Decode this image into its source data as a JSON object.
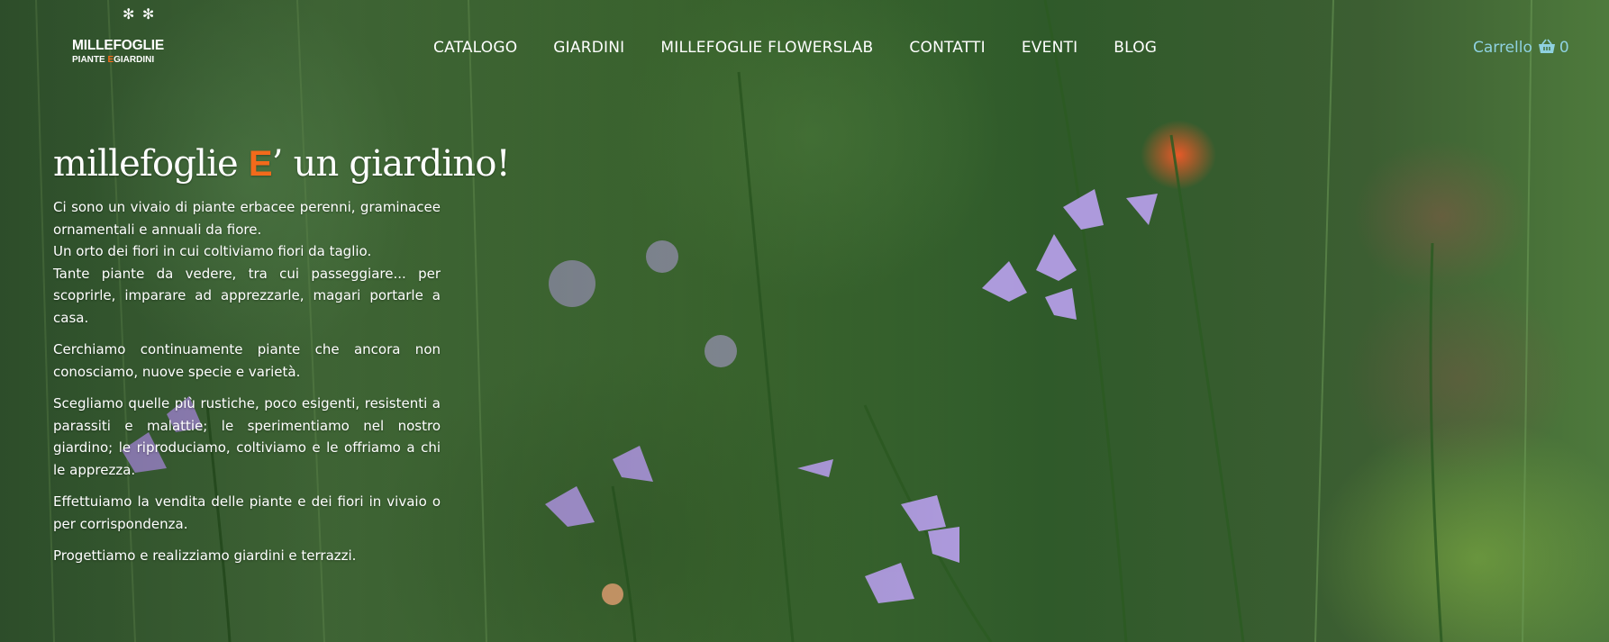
{
  "header": {
    "logo": {
      "line1": "MILLEFOGLIE",
      "line2_a": "PIANTE ",
      "line2_e": "E",
      "line2_b": "GIARDINI",
      "mark": "✻ ✻"
    },
    "nav": [
      {
        "label": "CATALOGO"
      },
      {
        "label": "GIARDINI"
      },
      {
        "label": "MILLEFOGLIE FLOWERSLAB"
      },
      {
        "label": "CONTATTI"
      },
      {
        "label": "EVENTI"
      },
      {
        "label": "BLOG"
      }
    ],
    "cart": {
      "label": "Carrello",
      "icon": "basket-icon",
      "count": "0"
    }
  },
  "hero": {
    "title_a": "millefoglie ",
    "title_e": "E",
    "title_b": "’ un giardino!",
    "paragraphs": [
      {
        "lines": [
          "Ci sono un vivaio di piante erbacee perenni, graminacee ornamentali e annuali da fiore.",
          "Un orto dei fiori in cui coltiviamo fiori da taglio.",
          "Tante piante da vedere, tra cui passeggiare... per scoprirle, imparare ad apprezzarle, magari portarle a casa."
        ]
      },
      {
        "lines": [
          "Cerchiamo continuamente piante che ancora non conosciamo, nuove specie e varietà."
        ]
      },
      {
        "lines": [
          "Scegliamo quelle più rustiche, poco esigenti, resistenti a parassiti e malattie; le sperimentiamo nel nostro giardino; le riproduciamo, coltiviamo e le offriamo a chi le apprezza."
        ]
      },
      {
        "lines": [
          "Effettuiamo la vendita delle piante e dei fiori in vivaio o per corrispondenza."
        ]
      },
      {
        "lines": [
          "Progettiamo e realizziamo giardini e terrazzi."
        ]
      }
    ]
  },
  "colors": {
    "accent": "#f26a1b",
    "cart": "#8fd1e0",
    "text": "#ffffff"
  }
}
